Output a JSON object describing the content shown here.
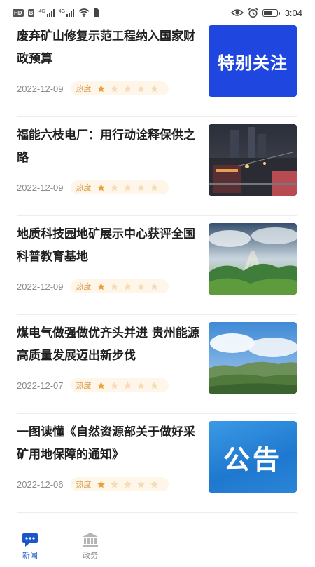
{
  "status_bar": {
    "badge_hd": "HD",
    "badge_b": "B",
    "sig1_tech": "4G",
    "sig2_tech": "4G",
    "time": "3:04"
  },
  "articles": [
    {
      "title": "废弃矿山修复示范工程纳入国家财政预算",
      "date": "2022-12-09",
      "heat_label": "热度",
      "heat_stars": 1,
      "thumb_type": "text",
      "thumb_text": "特别关注"
    },
    {
      "title": "福能六枝电厂：用行动诠释保供之路",
      "date": "2022-12-09",
      "heat_label": "热度",
      "heat_stars": 1,
      "thumb_type": "night-plant",
      "thumb_text": ""
    },
    {
      "title": "地质科技园地矿展示中心获评全国科普教育基地",
      "date": "2022-12-09",
      "heat_label": "热度",
      "heat_stars": 1,
      "thumb_type": "green-hills",
      "thumb_text": ""
    },
    {
      "title": "煤电气做强做优齐头并进 贵州能源高质量发展迈出新步伐",
      "date": "2022-12-07",
      "heat_label": "热度",
      "heat_stars": 1,
      "thumb_type": "sky-mountain",
      "thumb_text": ""
    },
    {
      "title": "一图读懂《自然资源部关于做好采矿用地保障的通知》",
      "date": "2022-12-06",
      "heat_label": "热度",
      "heat_stars": 1,
      "thumb_type": "notice",
      "thumb_text": "公告"
    }
  ],
  "bottom_nav": {
    "items": [
      {
        "label": "新闻",
        "icon": "chat-bubble-icon",
        "active": true
      },
      {
        "label": "政务",
        "icon": "government-building-icon",
        "active": false
      }
    ]
  },
  "colors": {
    "accent": "#1c57c9",
    "star_on": "#e8a33c",
    "star_off": "#f5dcb7",
    "special_bg": "#1f47e0"
  }
}
